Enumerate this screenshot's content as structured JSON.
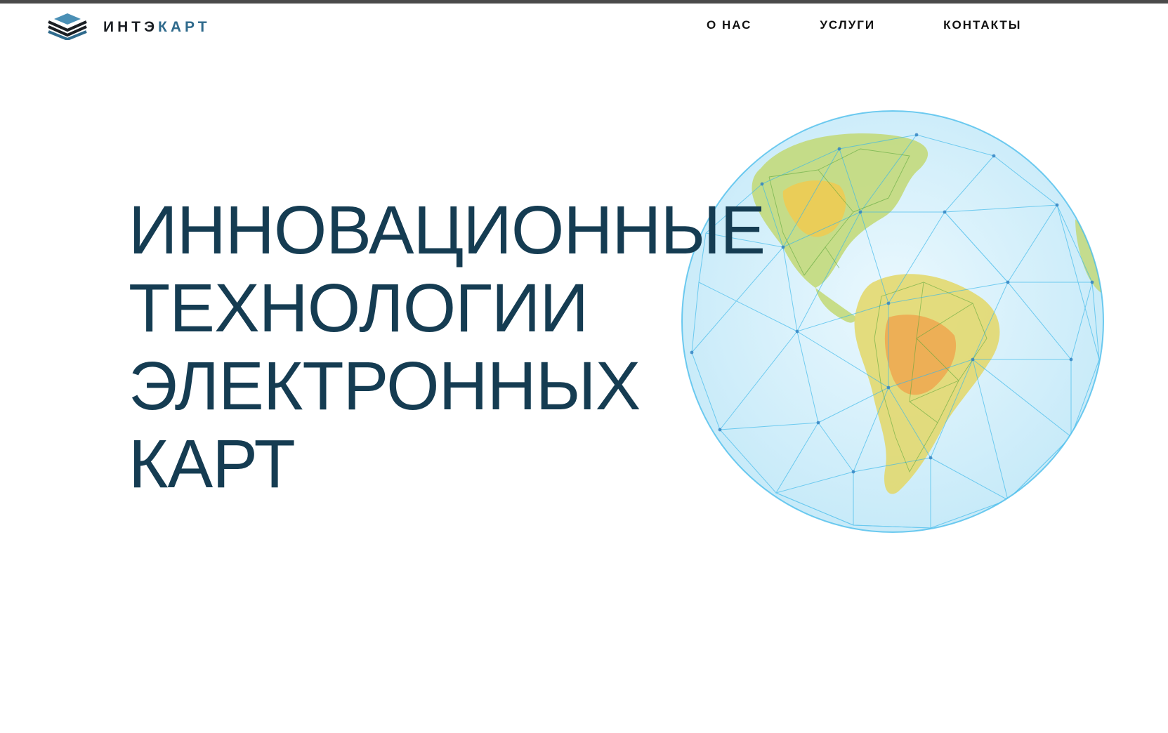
{
  "brand": {
    "name_part_dark": "ИНТЭ",
    "name_part_accent": "КАРТ",
    "logo_icon": "layered-chevrons-logo-icon",
    "colors": {
      "dark": "#1b1f24",
      "accent": "#2f6a8c",
      "accent_light": "#4a8fb5"
    }
  },
  "nav": {
    "items": [
      {
        "label": "О НАС"
      },
      {
        "label": "УСЛУГИ"
      },
      {
        "label": "КОНТАКТЫ"
      }
    ]
  },
  "hero": {
    "title_lines": [
      "ИННОВАЦИОННЫЕ",
      "ТЕХНОЛОГИИ",
      "ЭЛЕКТРОННЫХ",
      "КАРТ"
    ],
    "title_color": "#153c52",
    "illustration": "wireframe-globe-americas-illustration",
    "globe_colors": {
      "mesh": "#38b7ea",
      "land_green": "#6fae3a",
      "land_yellow": "#e8c84a",
      "land_red": "#e05a3a"
    }
  }
}
